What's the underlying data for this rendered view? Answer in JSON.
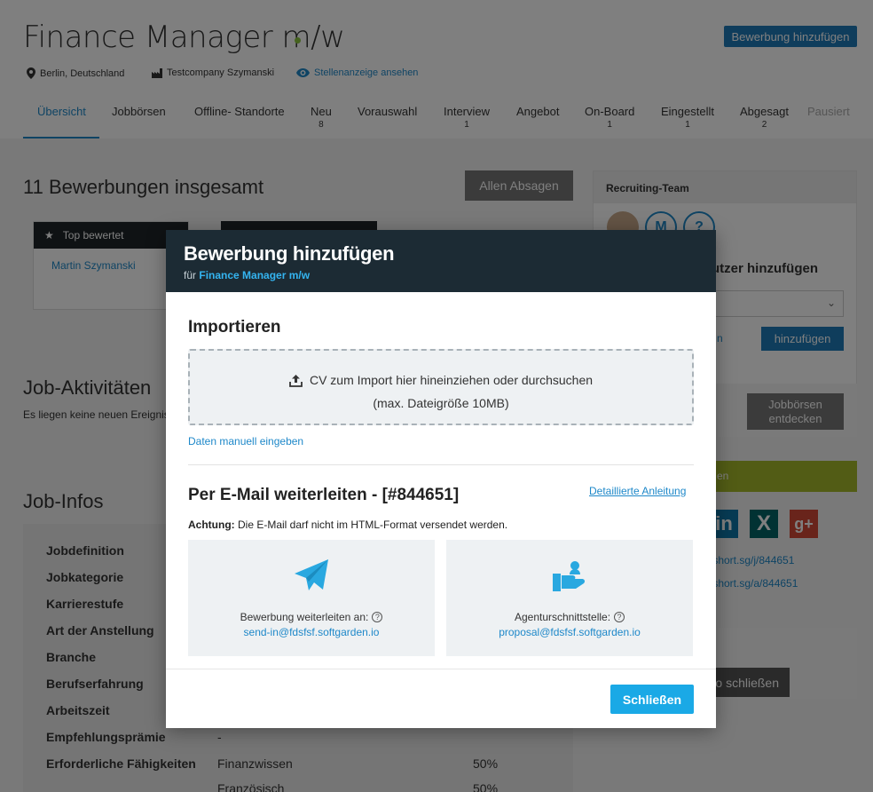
{
  "header": {
    "job_title": "Finance Manager m/w",
    "add_application_label": "Bewerbung hinzufügen",
    "location": "Berlin, Deutschland",
    "company": "Testcompany Szymanski",
    "view_posting": "Stellenanzeige ansehen"
  },
  "tabs": [
    {
      "label": "Übersicht",
      "count": ""
    },
    {
      "label": "Jobbörsen",
      "count": ""
    },
    {
      "label": "Offline- Standorte",
      "count": ""
    },
    {
      "label": "Neu",
      "count": "8"
    },
    {
      "label": "Vorauswahl",
      "count": ""
    },
    {
      "label": "Interview",
      "count": "1"
    },
    {
      "label": "Angebot",
      "count": ""
    },
    {
      "label": "On-Board",
      "count": "1"
    },
    {
      "label": "Eingestellt",
      "count": "1"
    },
    {
      "label": "Abgesagt",
      "count": "2"
    },
    {
      "label": "Pausiert",
      "count": ""
    }
  ],
  "main": {
    "applications_total": "11 Bewerbungen insgesamt",
    "reject_all": "Allen Absagen",
    "top_rated_label": "Top bewertet",
    "top_candidate": "Martin Szymanski",
    "activities_title": "Job-Aktivitäten",
    "activities_text": "Es liegen keine neuen Ereignisse",
    "infos_title": "Job-Infos",
    "info_rows": [
      {
        "label": "Jobdefinition",
        "value": "",
        "pct": ""
      },
      {
        "label": "Jobkategorie",
        "value": "",
        "pct": ""
      },
      {
        "label": "Karrierestufe",
        "value": "",
        "pct": ""
      },
      {
        "label": "Art der Anstellung",
        "value": "",
        "pct": ""
      },
      {
        "label": "Branche",
        "value": "",
        "pct": ""
      },
      {
        "label": "Berufserfahrung",
        "value": "",
        "pct": ""
      },
      {
        "label": "Arbeitszeit",
        "value": "",
        "pct": ""
      },
      {
        "label": "Empfehlungsprämie",
        "value": "-",
        "pct": ""
      },
      {
        "label": "Erforderliche Fähigkeiten",
        "value": "Finanzwissen",
        "pct": "50%"
      },
      {
        "label": "",
        "value": "Französisch",
        "pct": "50%"
      }
    ]
  },
  "sidebar": {
    "team_title": "Recruiting-Team",
    "avatar_m": "M",
    "avatar_q": "?",
    "add_user_label": "utzer hinzufügen",
    "add_button": "hinzufügen",
    "left_link_fragment": "n",
    "jobboards_button": "Jobbörsen entdecken",
    "green_label": "en",
    "short_link_1": "/short.sg/j/844651",
    "short_link_2": "/short.sg/a/844651",
    "close_job_button": "o schließen"
  },
  "modal": {
    "title": "Bewerbung hinzufügen",
    "subtitle_prefix": "für",
    "subtitle_job": "Finance Manager m/w",
    "import_title": "Importieren",
    "dropzone_line1": "CV zum Import hier hineinziehen oder durchsuchen",
    "dropzone_line2": "(max. Dateigröße 10MB)",
    "manual_entry": "Daten manuell eingeben",
    "email_title": "Per E-Mail weiterleiten - [#844651]",
    "guide_link": "Detaillierte Anleitung",
    "warning_bold": "Achtung:",
    "warning_text": "Die E-Mail darf nicht im HTML-Format versendet werden.",
    "card1_label": "Bewerbung weiterleiten an:",
    "card1_email": "send-in@fdsfsf.softgarden.io",
    "card2_label": "Agenturschnittstelle:",
    "card2_email": "proposal@fdsfsf.softgarden.io",
    "help": "?",
    "close_button": "Schließen"
  },
  "colors": {
    "accent": "#1e88c9",
    "modal_header": "#1c2b34",
    "close_button": "#1aa9e6",
    "icon_blue": "#29a8e0",
    "status_dot": "#8cc63f"
  },
  "icons": [
    "location-pin-icon",
    "factory-icon",
    "eye-icon",
    "star-icon",
    "upload-icon",
    "paper-plane-icon",
    "agency-hand-icon",
    "help-icon",
    "chevron-down-icon"
  ]
}
